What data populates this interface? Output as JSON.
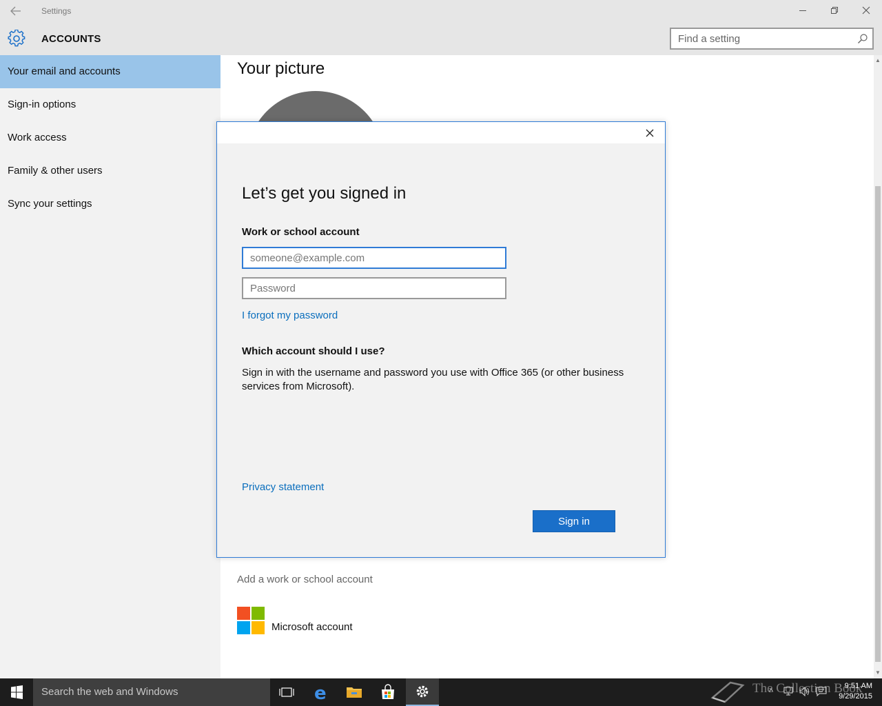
{
  "window": {
    "title": "Settings",
    "back_icon": "back-arrow-icon",
    "minimize_icon": "minimize-icon",
    "restore_icon": "restore-icon",
    "close_icon": "close-icon"
  },
  "header": {
    "section": "ACCOUNTS",
    "icon": "gear-icon",
    "search": {
      "placeholder": "Find a setting",
      "value": "",
      "icon": "search-icon"
    }
  },
  "sidebar": {
    "items": [
      {
        "label": "Your email and accounts",
        "active": true
      },
      {
        "label": "Sign-in options",
        "active": false
      },
      {
        "label": "Work access",
        "active": false
      },
      {
        "label": "Family & other users",
        "active": false
      },
      {
        "label": "Sync your settings",
        "active": false
      }
    ]
  },
  "main": {
    "picture_heading": "Your picture",
    "add_work_account": "Add a work or school account",
    "microsoft_account": "Microsoft account",
    "ms_logo_colors": [
      "#f25022",
      "#7fba00",
      "#00a4ef",
      "#ffb900"
    ]
  },
  "dialog": {
    "close_icon": "close-icon",
    "title": "Let’s get you signed in",
    "account_label": "Work or school account",
    "email": {
      "placeholder": "someone@example.com",
      "value": ""
    },
    "password": {
      "placeholder": "Password",
      "value": ""
    },
    "forgot_link": "I forgot my password",
    "which_heading": "Which account should I use?",
    "which_body": "Sign in with the username and password you use with Office 365 (or other business services from Microsoft).",
    "privacy_link": "Privacy statement",
    "signin_button": "Sign in"
  },
  "taskbar": {
    "start_icon": "windows-start-icon",
    "search_placeholder": "Search the web and Windows",
    "apps": [
      {
        "name": "task-view-icon",
        "active": false
      },
      {
        "name": "edge-icon",
        "active": false
      },
      {
        "name": "file-explorer-icon",
        "active": false
      },
      {
        "name": "store-icon",
        "active": false
      },
      {
        "name": "settings-icon",
        "active": true
      }
    ],
    "watermark": "The Collection Book",
    "clock": {
      "time": "9:51 AM",
      "date": "9/29/2015"
    }
  },
  "colors": {
    "accent": "#1a6fc9",
    "sidebar_active": "#99c4e9",
    "link": "#0a6ebd",
    "taskbar": "#1d1d1d"
  }
}
